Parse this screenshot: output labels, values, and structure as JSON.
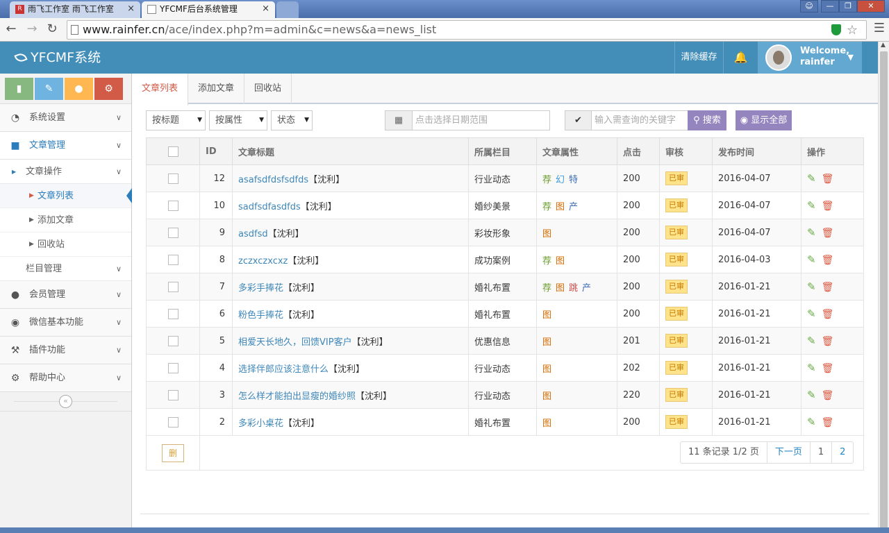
{
  "browser": {
    "tabs": [
      {
        "title": "雨飞工作室 雨飞工作室",
        "close": "×"
      },
      {
        "title": "YFCMF后台系统管理",
        "close": "×"
      }
    ],
    "url_host": "www.rainfer.cn",
    "url_path": "/ace/index.php?m=admin&c=news&a=news_list"
  },
  "header": {
    "logo": "YFCMF系统",
    "clear_cache": "清除缓存",
    "welcome": "Welcome,",
    "username": "rainfer"
  },
  "sidebar": {
    "items": [
      {
        "label": "系统设置",
        "icon": "dashboard-icon"
      },
      {
        "label": "文章管理",
        "icon": "folder-icon"
      },
      {
        "label": "会员管理",
        "icon": "users-icon"
      },
      {
        "label": "微信基本功能",
        "icon": "wechat-icon"
      },
      {
        "label": "插件功能",
        "icon": "wrench-icon"
      },
      {
        "label": "帮助中心",
        "icon": "cogs-icon"
      }
    ],
    "sub_group": "文章操作",
    "sub_items": [
      "文章列表",
      "添加文章",
      "回收站"
    ],
    "column_mgmt": "栏目管理"
  },
  "main": {
    "tabs": [
      "文章列表",
      "添加文章",
      "回收站"
    ],
    "filters": {
      "by_title": "按标题",
      "by_attr": "按属性",
      "status": "状态",
      "date_placeholder": "点击选择日期范围",
      "keyword_placeholder": "输入需查询的关键字",
      "search": "搜索",
      "show_all": "显示全部"
    },
    "columns": [
      "ID",
      "文章标题",
      "所属栏目",
      "文章属性",
      "点击",
      "审核",
      "发布时间",
      "操作"
    ],
    "rows": [
      {
        "id": "12",
        "title": "asafsdfdsfsdfds",
        "suffix": "【沈利】",
        "category": "行业动态",
        "flags": [
          "荐",
          "幻",
          "特"
        ],
        "hits": "200",
        "status": "已审",
        "date": "2016-04-07"
      },
      {
        "id": "10",
        "title": "sadfsdfasdfds",
        "suffix": "【沈利】",
        "category": "婚纱美景",
        "flags": [
          "荐",
          "图",
          "产"
        ],
        "hits": "200",
        "status": "已审",
        "date": "2016-04-07"
      },
      {
        "id": "9",
        "title": "asdfsd",
        "suffix": "【沈利】",
        "category": "彩妆形象",
        "flags": [
          "图"
        ],
        "hits": "200",
        "status": "已审",
        "date": "2016-04-07"
      },
      {
        "id": "8",
        "title": "zczxczxcxz",
        "suffix": "【沈利】",
        "category": "成功案例",
        "flags": [
          "荐",
          "图"
        ],
        "hits": "200",
        "status": "已审",
        "date": "2016-04-03"
      },
      {
        "id": "7",
        "title": "多彩手捧花",
        "suffix": "【沈利】",
        "category": "婚礼布置",
        "flags": [
          "荐",
          "图",
          "跳",
          "产"
        ],
        "hits": "200",
        "status": "已审",
        "date": "2016-01-21"
      },
      {
        "id": "6",
        "title": "粉色手捧花",
        "suffix": "【沈利】",
        "category": "婚礼布置",
        "flags": [
          "图"
        ],
        "hits": "200",
        "status": "已审",
        "date": "2016-01-21"
      },
      {
        "id": "5",
        "title": "相爱天长地久，回馈VIP客户",
        "suffix": "【沈利】",
        "category": "优惠信息",
        "flags": [
          "图"
        ],
        "hits": "201",
        "status": "已审",
        "date": "2016-01-21"
      },
      {
        "id": "4",
        "title": "选择伴郎应该注意什么",
        "suffix": "【沈利】",
        "category": "行业动态",
        "flags": [
          "图"
        ],
        "hits": "202",
        "status": "已审",
        "date": "2016-01-21"
      },
      {
        "id": "3",
        "title": "怎么样才能拍出显瘦的婚纱照",
        "suffix": "【沈利】",
        "category": "行业动态",
        "flags": [
          "图"
        ],
        "hits": "220",
        "status": "已审",
        "date": "2016-01-21"
      },
      {
        "id": "2",
        "title": "多彩小桌花",
        "suffix": "【沈利】",
        "category": "婚礼布置",
        "flags": [
          "图"
        ],
        "hits": "200",
        "status": "已审",
        "date": "2016-01-21"
      }
    ],
    "delete_label": "删",
    "pager": {
      "summary": "11 条记录 1/2 页",
      "next": "下一页",
      "pages": [
        "1",
        "2"
      ]
    }
  },
  "colors": {
    "header": "#438eb9",
    "flag_recommend": "#6c9e2f",
    "flag_image": "#d46b00",
    "flag_special": "#3a6db5",
    "flag_jump": "#d14b4b",
    "flag_product": "#3a6db5",
    "flag_magic": "#3a9be0"
  }
}
